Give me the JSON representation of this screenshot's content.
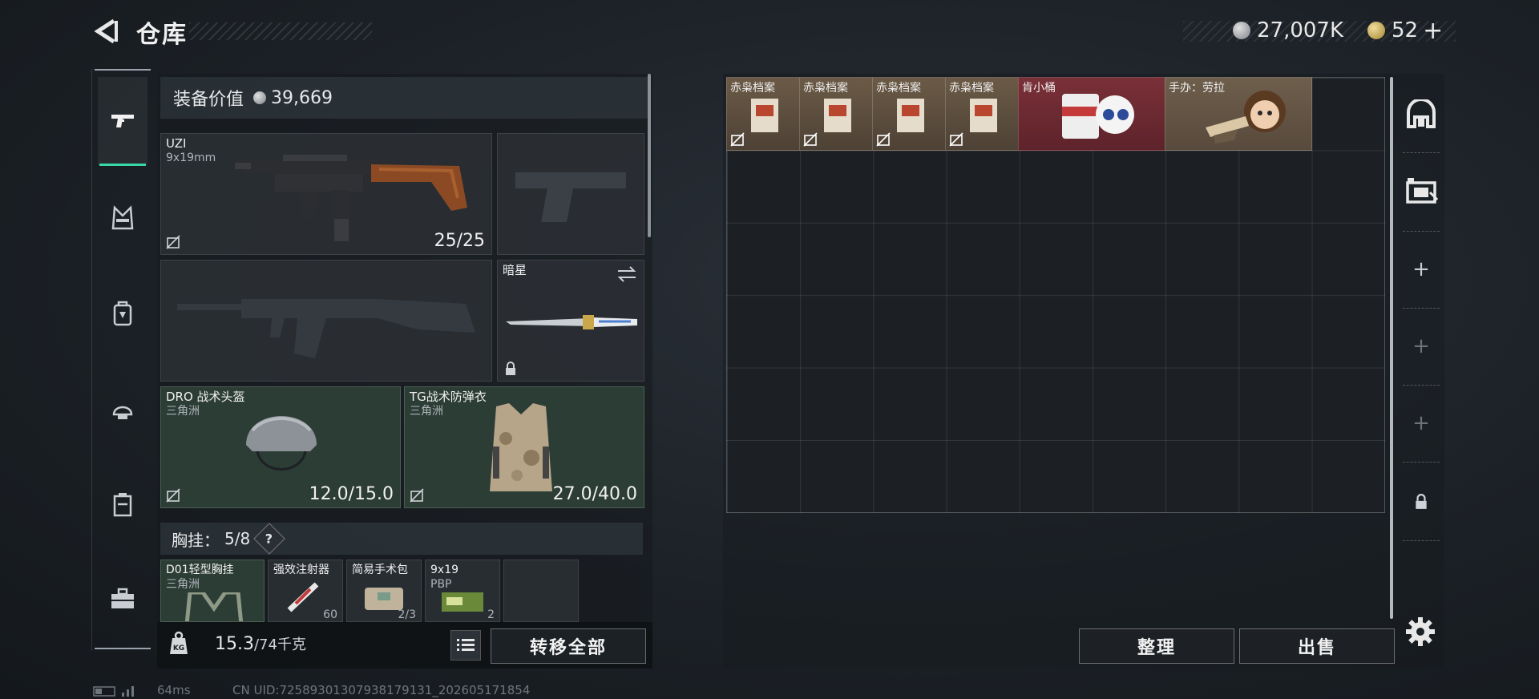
{
  "header": {
    "title": "仓库",
    "silver_amount": "27,007K",
    "gold_amount": "52",
    "add_label": "+"
  },
  "nav": {
    "items": [
      "pistol-icon",
      "vest-icon",
      "backpack-icon",
      "helmet-icon",
      "case-icon",
      "toolbox-icon"
    ]
  },
  "equipment": {
    "value_label": "装备价值",
    "value": "39,669",
    "primary": {
      "name": "UZI",
      "caliber": "9x19mm",
      "ammo": "25/25"
    },
    "melee": {
      "name": "暗星"
    },
    "helmet": {
      "name": "DRO 战术头盔",
      "brand": "三角洲",
      "durability": "12.0/15.0"
    },
    "armor": {
      "name": "TG战术防弹衣",
      "brand": "三角洲",
      "durability": "27.0/40.0"
    },
    "rig": {
      "label": "胸挂：",
      "capacity": "5/8",
      "help": "?",
      "items": [
        {
          "name": "D01轻型胸挂",
          "brand": "三角洲"
        },
        {
          "name": "强效注射器",
          "count": "60"
        },
        {
          "name": "简易手术包",
          "count": "2/3"
        },
        {
          "name": "9x19",
          "sub": "PBP",
          "count": "2"
        }
      ]
    }
  },
  "bottom": {
    "weight": "15.3",
    "weight_max": "/74千克",
    "transfer_all": "转移全部"
  },
  "storage": {
    "items": [
      {
        "name": "赤枭档案",
        "color": "brown"
      },
      {
        "name": "赤枭档案",
        "color": "brown"
      },
      {
        "name": "赤枭档案",
        "color": "brown"
      },
      {
        "name": "赤枭档案",
        "color": "brown"
      },
      {
        "name": "肯小桶",
        "color": "red"
      },
      {
        "name": "手办：劳拉",
        "color": "tan"
      }
    ],
    "sort_label": "整理",
    "sell_label": "出售"
  },
  "footer": {
    "ping": "64ms",
    "uid": "CN UID:7258930130793817913​1_202605171854"
  }
}
